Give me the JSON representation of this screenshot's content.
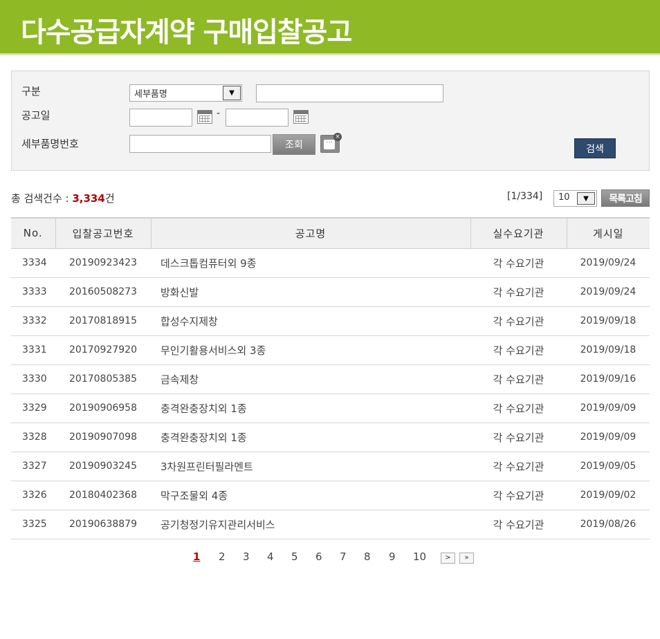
{
  "header": {
    "title": "다수공급자계약 구매입찰공고"
  },
  "search": {
    "category_label": "구분",
    "category_value": "세부품명",
    "category_text": "",
    "date_label": "공고일",
    "date_from": "",
    "date_sep": "-",
    "date_to": "",
    "item_no_label": "세부품명번호",
    "item_no_value": "",
    "lookup_label": "조회",
    "clear_dots": "···",
    "clear_x": "×",
    "search_label": "검색"
  },
  "summary": {
    "total_prefix": "총 검색건수 : ",
    "total_count": "3,334",
    "total_suffix": "건",
    "page_info": "[1/334]",
    "per_page": "10",
    "refresh_label": "목록고침"
  },
  "table": {
    "headers": [
      "No.",
      "입찰공고번호",
      "공고명",
      "실수요기관",
      "게시일"
    ],
    "rows": [
      [
        "3334",
        "20190923423",
        "데스크톱컴퓨터외 9종",
        "각 수요기관",
        "2019/09/24"
      ],
      [
        "3333",
        "20160508273",
        "방화신발",
        "각 수요기관",
        "2019/09/24"
      ],
      [
        "3332",
        "20170818915",
        "합성수지제창",
        "각 수요기관",
        "2019/09/18"
      ],
      [
        "3331",
        "20170927920",
        "무인기활용서비스외 3종",
        "각 수요기관",
        "2019/09/18"
      ],
      [
        "3330",
        "20170805385",
        "금속제창",
        "각 수요기관",
        "2019/09/16"
      ],
      [
        "3329",
        "20190906958",
        "충격완충장치외 1종",
        "각 수요기관",
        "2019/09/09"
      ],
      [
        "3328",
        "20190907098",
        "충격완충장치외 1종",
        "각 수요기관",
        "2019/09/09"
      ],
      [
        "3327",
        "20190903245",
        "3차원프린터필라멘트",
        "각 수요기관",
        "2019/09/05"
      ],
      [
        "3326",
        "20180402368",
        "막구조물외 4종",
        "각 수요기관",
        "2019/09/02"
      ],
      [
        "3325",
        "20190638879",
        "공기청정기유지관리서비스",
        "각 수요기관",
        "2019/08/26"
      ]
    ]
  },
  "pagination": {
    "pages": [
      "1",
      "2",
      "3",
      "4",
      "5",
      "6",
      "7",
      "8",
      "9",
      "10"
    ],
    "current": "1",
    "next": ">",
    "last": "»"
  },
  "colors": {
    "header_bg": "#8fb925",
    "search_btn": "#2e4b6e",
    "count": "#b10000"
  },
  "icons": {
    "select_arrow": "chevron-down-icon",
    "date_picker": "calendar-icon",
    "clear": "clear-icon"
  }
}
